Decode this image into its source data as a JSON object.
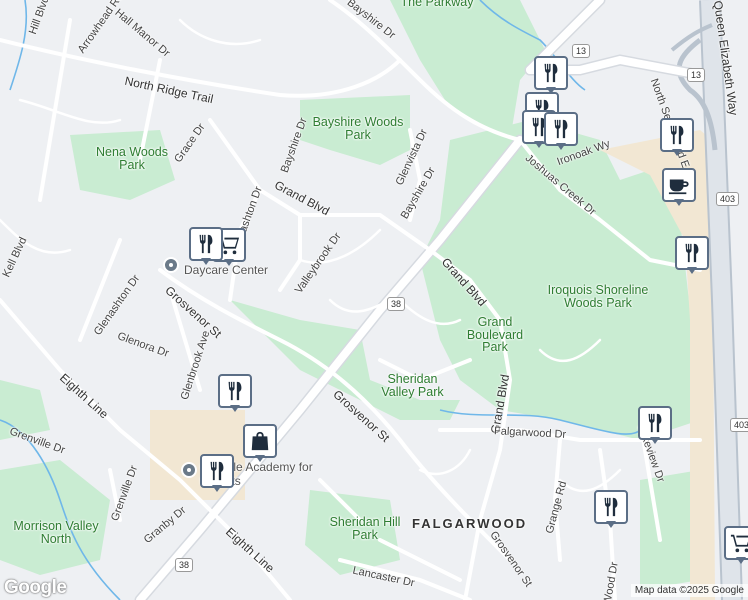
{
  "map": {
    "attribution": "Map data ©2025 Google",
    "logo": "Google",
    "colors": {
      "land": "#eef0f3",
      "park": "#c9ecd2",
      "road": "#ffffff",
      "road_casing": "#d6dae0",
      "highway": "#b9c3ce",
      "water": "#6fb7e9",
      "commercial": "#f2e7d3",
      "pin_border": "#5b6e86"
    },
    "parks": [
      {
        "label": "Bayshire Woods Park"
      },
      {
        "label": "Nena Woods Park"
      },
      {
        "label": "Iroquois Shoreline Woods Park"
      },
      {
        "label": "Grand Boulevard Park"
      },
      {
        "label": "Sheridan Valley Park"
      },
      {
        "label": "Sheridan Hill Park"
      },
      {
        "label": "Morrison Valley North"
      },
      {
        "label": "The Parkway"
      }
    ],
    "streets": [
      "Bayshire Dr",
      "Arrowhead Rd",
      "Hall Manor Dr",
      "Hill Blvd",
      "North Ridge Trail",
      "Grace Dr",
      "Bayshire Dr",
      "Grand Blvd",
      "Glenashton Dr",
      "Glenvista Dr",
      "Bayshire Dr",
      "Valleybrook Dr",
      "Glenashton Dr",
      "Grosvenor St",
      "Glenora Dr",
      "Glenbrook Ave",
      "Eighth Line",
      "Grenville Dr",
      "Grenville Dr",
      "Granby Dr",
      "Grosvenor St",
      "Eighth Line",
      "Grand Blvd",
      "Grand Blvd",
      "Falgarwood Dr",
      "Lakeview Dr",
      "Grange Rd",
      "Grosvenor St",
      "Lancaster Dr",
      "Joshuas Creek Dr",
      "Ironoak Wy",
      "North Service Rd E",
      "Queen Elizabeth Way",
      "Kell Blvd",
      "Wood Dr"
    ],
    "areas": [
      "FALGARWOOD"
    ],
    "places": [
      {
        "label": "Daycare Center",
        "icon": "place-dot-icon"
      },
      {
        "label": "Oakville Academy for the Arts",
        "icon": "place-dot-icon"
      }
    ],
    "route_shields": [
      "13",
      "13",
      "38",
      "38",
      "403",
      "403"
    ],
    "markers": [
      {
        "icon": "restaurant-icon",
        "kind": "restaurant"
      },
      {
        "icon": "restaurant-icon",
        "kind": "restaurant"
      },
      {
        "icon": "restaurant-icon",
        "kind": "restaurant"
      },
      {
        "icon": "restaurant-icon",
        "kind": "restaurant"
      },
      {
        "icon": "restaurant-icon",
        "kind": "restaurant"
      },
      {
        "icon": "cafe-icon",
        "kind": "cafe"
      },
      {
        "icon": "restaurant-icon",
        "kind": "restaurant"
      },
      {
        "icon": "grocery-cart-icon",
        "kind": "grocery"
      },
      {
        "icon": "restaurant-icon",
        "kind": "restaurant"
      },
      {
        "icon": "restaurant-icon",
        "kind": "restaurant"
      },
      {
        "icon": "shopping-bag-icon",
        "kind": "shopping"
      },
      {
        "icon": "restaurant-icon",
        "kind": "restaurant"
      },
      {
        "icon": "restaurant-icon",
        "kind": "restaurant"
      },
      {
        "icon": "restaurant-icon",
        "kind": "restaurant"
      },
      {
        "icon": "grocery-cart-icon",
        "kind": "grocery"
      }
    ]
  }
}
